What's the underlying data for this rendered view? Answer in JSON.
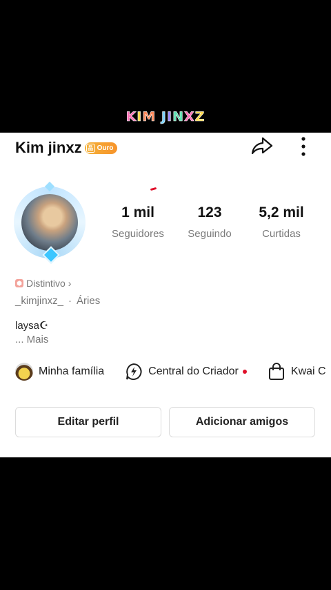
{
  "overlay": {
    "title_letters": [
      "K",
      "I",
      "M",
      " ",
      "J",
      "I",
      "N",
      "X",
      "Z"
    ]
  },
  "profile": {
    "name": "Kim jinxz",
    "badge_label": "Ouro",
    "distintivo_label": "Distintivo",
    "distintivo_chevron": "›",
    "username": "_kimjinxz_",
    "separator": "·",
    "sign": "Áries",
    "bio": "laysa☪︎",
    "more_label": "...  Mais"
  },
  "stats": [
    {
      "value": "1 mil",
      "label": "Seguidores"
    },
    {
      "value": "123",
      "label": "Seguindo"
    },
    {
      "value": "5,2 mil",
      "label": "Curtidas"
    }
  ],
  "shortcuts": [
    {
      "label": "Minha família",
      "icon": "family-avatar-icon"
    },
    {
      "label": "Central do Criador",
      "icon": "lightning-circle-icon",
      "has_dot": true
    },
    {
      "label": "Kwai C",
      "icon": "shopping-bag-icon"
    }
  ],
  "buttons": {
    "edit": "Editar perfil",
    "add": "Adicionar amigos"
  },
  "colors": {
    "badge": "#f4a032",
    "notification_dot": "#e0102a",
    "muted_text": "#777777"
  }
}
